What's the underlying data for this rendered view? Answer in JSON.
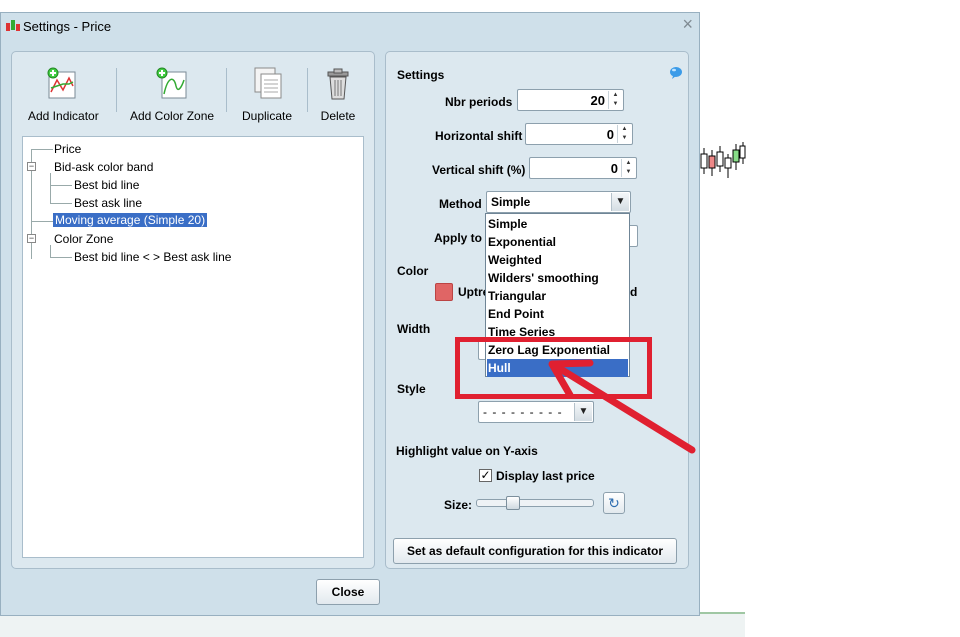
{
  "dialog": {
    "title": "Settings - Price",
    "close_x": "×"
  },
  "toolbar": {
    "add_indicator": "Add Indicator",
    "add_color_zone": "Add Color Zone",
    "duplicate": "Duplicate",
    "delete": "Delete"
  },
  "tree": {
    "price": "Price",
    "bid_ask": "Bid-ask color band",
    "best_bid": "Best bid line",
    "best_ask": "Best ask line",
    "moving_average": "Moving average (Simple 20)",
    "color_zone": "Color Zone",
    "zone_child": "Best bid line < > Best ask line"
  },
  "settings": {
    "header": "Settings",
    "nbr_periods_label": "Nbr periods",
    "nbr_periods_value": "20",
    "horizontal_shift_label": "Horizontal shift",
    "horizontal_shift_value": "0",
    "vertical_shift_label": "Vertical shift (%)",
    "vertical_shift_value": "0",
    "method_label": "Method",
    "method_value": "Simple",
    "apply_to_label": "Apply to",
    "color_label": "Color",
    "uptrend_label_partial": "Uptre",
    "trailing_d": "d",
    "width_label": "Width",
    "style_label": "Style",
    "style_value": "- - - - - - - - -",
    "highlight_label": "Highlight value on Y-axis",
    "display_last_price": "Display last price",
    "size_label": "Size:",
    "set_default_button": "Set as default configuration for this indicator"
  },
  "method_options": [
    "Simple",
    "Exponential",
    "Weighted",
    "Wilders' smoothing",
    "Triangular",
    "End Point",
    "Time Series",
    "Zero Lag Exponential",
    "Hull"
  ],
  "selected_method_option": "Hull",
  "close_button": "Close",
  "colors": {
    "accent_selection": "#3a6ec6",
    "swatch": "#e06565",
    "annotation": "#e02030",
    "dialog_bg": "#cfe0ea"
  }
}
